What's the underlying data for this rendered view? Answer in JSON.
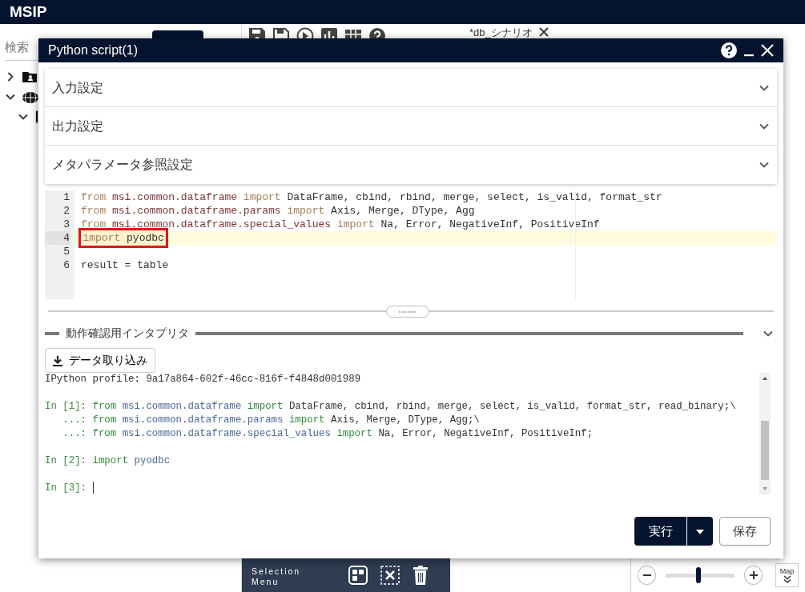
{
  "app": {
    "title": "MSIP"
  },
  "sidebar": {
    "search": {
      "placeholder": "検索"
    },
    "tree": [
      {
        "expanded": false
      },
      {
        "expanded": true,
        "children": [
          {
            "expanded": true
          }
        ]
      }
    ]
  },
  "tabs": [
    {
      "label": "*db_シナリオ",
      "selected": true
    }
  ],
  "dialog": {
    "title": "Python script(1)",
    "sections": [
      {
        "label": "入力設定",
        "expanded": false
      },
      {
        "label": "出力設定",
        "expanded": false
      },
      {
        "label": "メタパラメータ参照設定",
        "expanded": false
      }
    ],
    "editor": {
      "lines": [
        {
          "number": "1",
          "active": false,
          "tokens": [
            {
              "kind": "keyword",
              "text": "from"
            },
            {
              "kind": "module",
              "text": " msi.common.dataframe "
            },
            {
              "kind": "keyword",
              "text": "import"
            },
            {
              "kind": "plain",
              "text": " DataFrame, cbind, rbind, merge, select, is_valid, format_str"
            }
          ]
        },
        {
          "number": "2",
          "active": false,
          "tokens": [
            {
              "kind": "keyword",
              "text": "from"
            },
            {
              "kind": "module",
              "text": " msi.common.dataframe.params "
            },
            {
              "kind": "keyword",
              "text": "import"
            },
            {
              "kind": "plain",
              "text": " Axis, Merge, DType, Agg"
            }
          ]
        },
        {
          "number": "3",
          "active": false,
          "tokens": [
            {
              "kind": "keyword",
              "text": "from"
            },
            {
              "kind": "module",
              "text": " msi.common.dataframe.special_values "
            },
            {
              "kind": "keyword",
              "text": "import"
            },
            {
              "kind": "plain",
              "text": " Na, Error, NegativeInf, PositiveInf"
            }
          ]
        },
        {
          "number": "4",
          "active": true,
          "marked": true,
          "tokens": [
            {
              "kind": "keyword",
              "text": "import"
            },
            {
              "kind": "plain",
              "text": " pyodbc"
            }
          ]
        },
        {
          "number": "5",
          "active": false
        },
        {
          "number": "6",
          "active": false,
          "tokens": [
            {
              "kind": "plain",
              "text": "result = table"
            }
          ]
        }
      ]
    },
    "interpreter": {
      "title": "動作確認用インタプリタ",
      "expanded": true,
      "import_button": "データ取り込み",
      "console": [
        {
          "tokens": [
            {
              "kind": "plain",
              "text": "IPython profile: 9a17a864-602f-46cc-816f-f4848d001989"
            }
          ]
        },
        {
          "spaced": true,
          "tokens": [
            {
              "kind": "prompt",
              "text": "In [1]: "
            },
            {
              "kind": "keyword",
              "text": "from"
            },
            {
              "kind": "module",
              "text": " msi.common.dataframe "
            },
            {
              "kind": "keyword",
              "text": "import"
            },
            {
              "kind": "plain",
              "text": " DataFrame, cbind, rbind, merge, select, is_valid, format_str, read_binary;\\"
            }
          ]
        },
        {
          "tokens": [
            {
              "kind": "prompt",
              "text": "   ...: "
            },
            {
              "kind": "keyword",
              "text": "from"
            },
            {
              "kind": "module",
              "text": " msi.common.dataframe.params "
            },
            {
              "kind": "keyword",
              "text": "import"
            },
            {
              "kind": "plain",
              "text": " Axis, Merge, DType, Agg;\\"
            }
          ]
        },
        {
          "tokens": [
            {
              "kind": "prompt",
              "text": "   ...: "
            },
            {
              "kind": "keyword",
              "text": "from"
            },
            {
              "kind": "module",
              "text": " msi.common.dataframe.special_values "
            },
            {
              "kind": "keyword",
              "text": "import"
            },
            {
              "kind": "plain",
              "text": " Na, Error, NegativeInf, PositiveInf;"
            }
          ]
        },
        {
          "spaced": true,
          "tokens": [
            {
              "kind": "prompt",
              "text": "In [2]: "
            },
            {
              "kind": "keyword",
              "text": "import"
            },
            {
              "kind": "module",
              "text": " pyodbc"
            }
          ]
        },
        {
          "spaced": true,
          "tokens": [
            {
              "kind": "prompt",
              "text": "In [3]: "
            }
          ],
          "cursor": true
        }
      ]
    },
    "run_button": "実行",
    "save_button": "保存"
  },
  "selection_menu": {
    "lines": [
      "Selection",
      "Menu"
    ]
  },
  "zoom": {
    "level": 0.47,
    "map_label": "Map"
  }
}
